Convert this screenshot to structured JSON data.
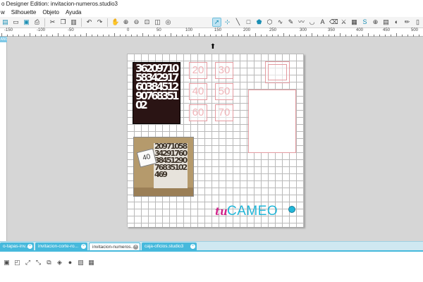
{
  "window": {
    "title": "o Designer Edition: invitacion-numeros.studio3"
  },
  "menu": {
    "items": [
      "w",
      "Silhouette",
      "Objeto",
      "Ayuda"
    ]
  },
  "toolbar": {
    "left_icons": [
      "new-icon",
      "open-icon",
      "save-icon",
      "print-icon",
      "cut-icon",
      "copy-icon",
      "paste-icon",
      "undo-icon",
      "redo-icon",
      "pan-icon",
      "zoom-in-icon",
      "zoom-out-icon",
      "zoom-box-icon",
      "zoom-fit-icon",
      "zoom-all-icon"
    ],
    "right_icons": [
      "select-icon",
      "edit-points-icon",
      "line-icon",
      "square-icon",
      "pentagon-icon",
      "polygon-icon",
      "curve-icon",
      "freehand-icon",
      "smooth-icon",
      "arc-icon",
      "text-icon",
      "eraser-icon",
      "knife-icon",
      "library-icon",
      "store-icon",
      "crosshair-icon",
      "grid-icon",
      "palette-icon",
      "pencil-icon",
      "page-icon"
    ]
  },
  "ruler": {
    "labels": [
      "-150",
      "-100",
      "-50",
      "0",
      "50",
      "100",
      "150",
      "200",
      "250",
      "300",
      "350",
      "400",
      "450",
      "500"
    ],
    "corner": "ANO"
  },
  "canvas": {
    "cut_card_numbers": "3620971058342917603845129076835102",
    "photo_numbers": "20971058342917603845129076835102469",
    "photo_tag": "40",
    "number_boxes": [
      "20",
      "30",
      "40",
      "50",
      "60",
      "70"
    ]
  },
  "logo": {
    "tu": "tu",
    "cameo": "CAMEO"
  },
  "tabs": [
    {
      "label": "o-tapas-inv...",
      "active": false
    },
    {
      "label": "invitacion-corte-ro...",
      "active": false
    },
    {
      "label": "invitacion-numeros...",
      "active": true
    },
    {
      "label": "caja-oficios.studio3",
      "active": false
    }
  ],
  "bottom_toolbar": {
    "icons": [
      "group-icon",
      "ungroup-icon",
      "compound-icon",
      "release-icon",
      "offset-icon",
      "trace-icon",
      "fill-icon",
      "line-style-icon",
      "image-icon"
    ]
  }
}
